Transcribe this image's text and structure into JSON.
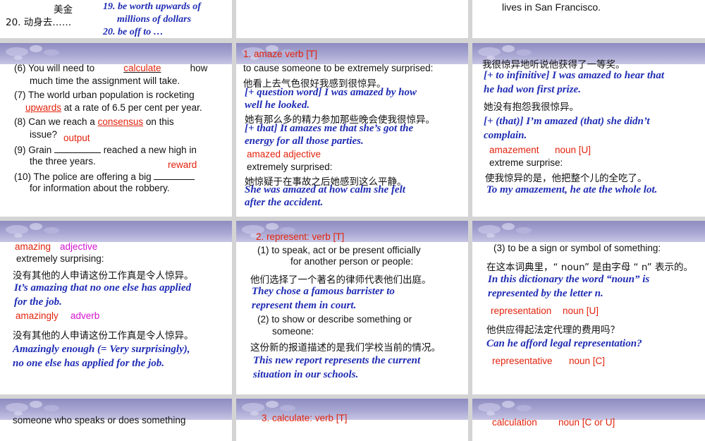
{
  "top_left": {
    "line_a": "美金",
    "line_b": "20. 动身去……",
    "line_c": "19. be worth upwards of",
    "line_d": "millions of dollars",
    "line_e": "20. be off to …"
  },
  "top_right": {
    "line_a": "lives in San Francisco."
  },
  "exercises": {
    "q6": {
      "pre": "(6) You will need to",
      "answer": "calculate",
      "post": "how",
      "cont": "much time the assignment will take."
    },
    "q7": {
      "text": "(7) The world urban population is rocketing",
      "answer": "upwards",
      "cont": "at a rate of 6.5 per cent per year."
    },
    "q8": {
      "pre": "(8) Can we reach a",
      "answer": "consensus",
      "post": "on this",
      "cont": "issue?",
      "answer2": "output"
    },
    "q9": {
      "pre": "(9) Grain",
      "post": "reached a new high in",
      "cont": "the three years.",
      "answer": "reward"
    },
    "q10": {
      "text": "(10) The police are offering a big",
      "cont": "for information about the robbery."
    }
  },
  "amaze": {
    "head": "1. amaze   verb [T]",
    "def": "to cause someone to be extremely surprised:",
    "zh1": "他看上去气色很好我感到很惊异。",
    "en1a": "[+ question word] I was amazed by how",
    "en1b": "well he looked.",
    "zh2": "她有那么多的精力参加那些晚会使我很惊异。",
    "en2a": "[+ that] It amazes me that she’s got the",
    "en2b": "energy for all those parties.",
    "adj": "amazed adjective",
    "adj_def": "extremely surprised:",
    "zh3": "她惊疑于在事故之后她感到这么平静。",
    "en3a": "She was amazed at how calm she felt",
    "en3b": "after the accident."
  },
  "amaze2": {
    "zh1": "我很惊异地听说他获得了一等奖。",
    "en1a": "[+ to infinitive] I was amazed to hear that",
    "en1b": "he had won first prize.",
    "zh2": "她没有抱怨我很惊异。",
    "en2a": "[+ (that)] I’m amazed (that) she didn’t",
    "en2b": "complain.",
    "noun": "amazement",
    "noun_pos": "noun [U]",
    "noun_def": "extreme surprise:",
    "zh3": "使我惊异的是，他把整个儿的全吃了。",
    "en3": "To my amazement, he ate the whole lot."
  },
  "amazing": {
    "word": "amazing",
    "pos": "adjective",
    "def": "extremely surprising:",
    "zh1": "没有其他的人申请这份工作真是令人惊异。",
    "en1a": "It’s amazing that no one else has applied",
    "en1b": "for the job.",
    "adv_word": "amazingly",
    "adv_pos": "adverb",
    "zh2": "没有其他的人申请这份工作真是令人惊异。",
    "en2a": "Amazingly enough (= Very surprisingly),",
    "en2b": "no one else has applied for the job."
  },
  "represent": {
    "head": "2. represent: verb [T]",
    "def1a": "(1) to speak, act or be present officially",
    "def1b": "for another person or people:",
    "zh1": "他们选择了一个著名的律师代表他们出庭。",
    "en1a": "They chose a famous barrister to",
    "en1b": "represent them in court.",
    "def2a": "(2) to show or describe something or",
    "def2b": "someone:",
    "zh2": "这份新的报道描述的是我们学校当前的情况。",
    "en2a": "This new report represents the current",
    "en2b": "situation in our schools."
  },
  "represent2": {
    "def3": "(3) to be a sign or symbol of something:",
    "zh1": "在这本词典里，“ noun” 是由字母 “ n” 表示的。",
    "en1a": "In this dictionary the word “noun” is",
    "en1b": "represented by the letter n.",
    "n1": "representation",
    "n1_pos": "noun [U]",
    "zh2": "他供应得起法定代理的费用吗？",
    "en2": "Can he afford legal representation?",
    "n2": "representative",
    "n2_pos": "noun [C]"
  },
  "bottom": {
    "left": "someone who speaks or does something",
    "mid": "3. calculate: verb [T]",
    "right_a": "calculation",
    "right_b": "noun [C or U]"
  }
}
